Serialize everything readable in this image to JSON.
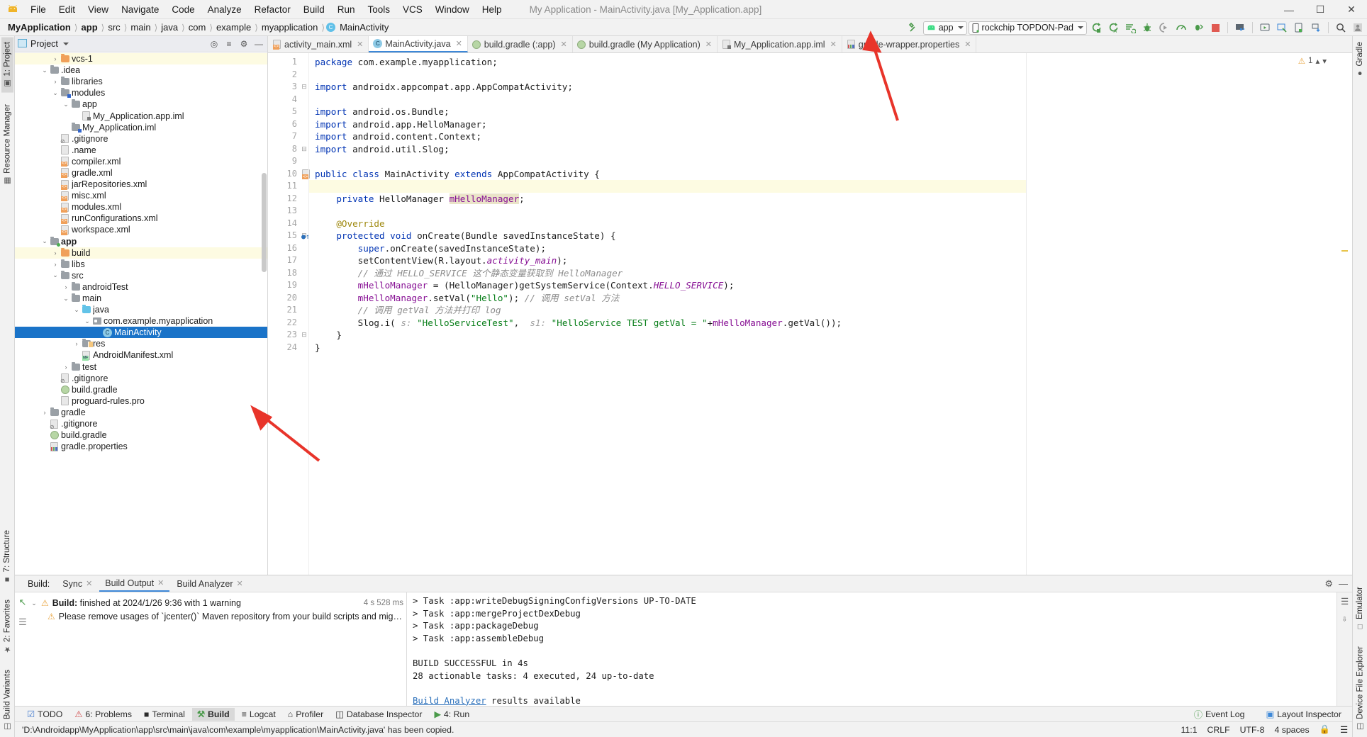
{
  "window": {
    "title": "My Application - MainActivity.java [My_Application.app]",
    "minimize": "—",
    "maximize": "☐",
    "close": "✕"
  },
  "menu": {
    "items": [
      "File",
      "Edit",
      "View",
      "Navigate",
      "Code",
      "Analyze",
      "Refactor",
      "Build",
      "Run",
      "Tools",
      "VCS",
      "Window",
      "Help"
    ]
  },
  "breadcrumb": {
    "items": [
      "MyApplication",
      "app",
      "src",
      "main",
      "java",
      "com",
      "example",
      "myapplication",
      "MainActivity"
    ],
    "class_icon": "C"
  },
  "toolbar": {
    "run_config": "app",
    "device": "rockchip TOPDON-Pad",
    "icons": [
      "hammer-build-icon",
      "run-icon",
      "run-coverage-icon",
      "apply-changes-icon",
      "debug-icon",
      "attach-debugger-icon",
      "profiler-icon",
      "apply-code-changes-icon",
      "stop-icon",
      "sdk-manager-icon",
      "avd-manager-icon",
      "layout-inspector-icon",
      "device-file-explorer-icon",
      "sync-gradle-icon",
      "search-icon",
      "avatar-icon"
    ]
  },
  "project_panel": {
    "title": "Project",
    "header_icons": [
      "target-icon",
      "collapse-all-icon",
      "settings-icon",
      "hide-icon"
    ],
    "tree": [
      {
        "label": "vcs-1",
        "depth": 3,
        "icon": "folder-orange",
        "twist": "›",
        "state": "highlight"
      },
      {
        "label": ".idea",
        "depth": 2,
        "icon": "folder",
        "twist": "⌄"
      },
      {
        "label": "libraries",
        "depth": 3,
        "icon": "folder",
        "twist": "›"
      },
      {
        "label": "modules",
        "depth": 3,
        "icon": "folder-module",
        "twist": "⌄"
      },
      {
        "label": "app",
        "depth": 4,
        "icon": "folder",
        "twist": "⌄"
      },
      {
        "label": "My_Application.app.iml",
        "depth": 5,
        "icon": "iml-file",
        "twist": ""
      },
      {
        "label": "My_Application.iml",
        "depth": 4,
        "icon": "iml-module",
        "twist": ""
      },
      {
        "label": ".gitignore",
        "depth": 3,
        "icon": "gitignore-file",
        "twist": ""
      },
      {
        "label": ".name",
        "depth": 3,
        "icon": "text-file",
        "twist": ""
      },
      {
        "label": "compiler.xml",
        "depth": 3,
        "icon": "xml-file",
        "twist": ""
      },
      {
        "label": "gradle.xml",
        "depth": 3,
        "icon": "xml-file",
        "twist": ""
      },
      {
        "label": "jarRepositories.xml",
        "depth": 3,
        "icon": "xml-file",
        "twist": ""
      },
      {
        "label": "misc.xml",
        "depth": 3,
        "icon": "xml-file",
        "twist": ""
      },
      {
        "label": "modules.xml",
        "depth": 3,
        "icon": "xml-file",
        "twist": ""
      },
      {
        "label": "runConfigurations.xml",
        "depth": 3,
        "icon": "xml-file",
        "twist": ""
      },
      {
        "label": "workspace.xml",
        "depth": 3,
        "icon": "xml-file",
        "twist": ""
      },
      {
        "label": "app",
        "depth": 2,
        "icon": "folder-module-green",
        "twist": "⌄",
        "bold": true
      },
      {
        "label": "build",
        "depth": 3,
        "icon": "folder-orange",
        "twist": "›",
        "state": "highlight"
      },
      {
        "label": "libs",
        "depth": 3,
        "icon": "folder",
        "twist": "›"
      },
      {
        "label": "src",
        "depth": 3,
        "icon": "folder",
        "twist": "⌄"
      },
      {
        "label": "androidTest",
        "depth": 4,
        "icon": "folder",
        "twist": "›"
      },
      {
        "label": "main",
        "depth": 4,
        "icon": "folder",
        "twist": "⌄"
      },
      {
        "label": "java",
        "depth": 5,
        "icon": "folder-blue",
        "twist": "⌄"
      },
      {
        "label": "com.example.myapplication",
        "depth": 6,
        "icon": "package-icon",
        "twist": "⌄"
      },
      {
        "label": "MainActivity",
        "depth": 7,
        "icon": "class-icon",
        "twist": "",
        "state": "selected"
      },
      {
        "label": "res",
        "depth": 5,
        "icon": "res-folder",
        "twist": "›"
      },
      {
        "label": "AndroidManifest.xml",
        "depth": 5,
        "icon": "manifest-file",
        "twist": ""
      },
      {
        "label": "test",
        "depth": 4,
        "icon": "folder",
        "twist": "›"
      },
      {
        "label": ".gitignore",
        "depth": 3,
        "icon": "gitignore-file",
        "twist": ""
      },
      {
        "label": "build.gradle",
        "depth": 3,
        "icon": "gradle-file",
        "twist": ""
      },
      {
        "label": "proguard-rules.pro",
        "depth": 3,
        "icon": "text-file",
        "twist": ""
      },
      {
        "label": "gradle",
        "depth": 2,
        "icon": "folder",
        "twist": "›"
      },
      {
        "label": ".gitignore",
        "depth": 2,
        "icon": "gitignore-file",
        "twist": ""
      },
      {
        "label": "build.gradle",
        "depth": 2,
        "icon": "gradle-file",
        "twist": ""
      },
      {
        "label": "gradle.properties",
        "depth": 2,
        "icon": "properties-file",
        "twist": ""
      }
    ]
  },
  "editor": {
    "tabs": [
      {
        "label": "activity_main.xml",
        "icon": "xml-file",
        "active": false
      },
      {
        "label": "MainActivity.java",
        "icon": "class-icon",
        "active": true
      },
      {
        "label": "build.gradle (:app)",
        "icon": "gradle-file",
        "active": false
      },
      {
        "label": "build.gradle (My Application)",
        "icon": "gradle-file",
        "active": false
      },
      {
        "label": "My_Application.app.iml",
        "icon": "iml-file",
        "active": false
      },
      {
        "label": "gradle-wrapper.properties",
        "icon": "properties-file",
        "active": false
      }
    ],
    "warning_count": "1",
    "lines": [
      {
        "n": 1,
        "html": "<span class=\"kw\">package</span> com.example.myapplication;"
      },
      {
        "n": 2,
        "html": ""
      },
      {
        "n": 3,
        "html": "<span class=\"kw\">import</span> androidx.appcompat.app.AppCompatActivity;",
        "fold": "⊟"
      },
      {
        "n": 4,
        "html": ""
      },
      {
        "n": 5,
        "html": "<span class=\"kw\">import</span> android.os.Bundle;"
      },
      {
        "n": 6,
        "html": "<span class=\"kw\">import</span> android.app.HelloManager;"
      },
      {
        "n": 7,
        "html": "<span class=\"kw\">import</span> android.content.Context;"
      },
      {
        "n": 8,
        "html": "<span class=\"kw\">import</span> android.util.Slog;",
        "fold": "⊟"
      },
      {
        "n": 9,
        "html": ""
      },
      {
        "n": 10,
        "html": "<span class=\"kw\">public class</span> MainActivity <span class=\"kw\">extends</span> AppCompatActivity {",
        "gmark": "class-gutter-icon"
      },
      {
        "n": 11,
        "html": "",
        "hl": true
      },
      {
        "n": 12,
        "html": "    <span class=\"kw\">private</span> HelloManager <span class=\"hi-ident fld\">mHelloManager</span>;"
      },
      {
        "n": 13,
        "html": ""
      },
      {
        "n": 14,
        "html": "    <span class=\"ann\">@Override</span>"
      },
      {
        "n": 15,
        "html": "    <span class=\"kw\">protected void</span> onCreate(Bundle savedInstanceState) {",
        "gmark": "override-icon",
        "fold": "⊟"
      },
      {
        "n": 16,
        "html": "        <span class=\"kw\">super</span>.onCreate(savedInstanceState);"
      },
      {
        "n": 17,
        "html": "        setContentView(R.layout.<span class=\"stc\">activity_main</span>);"
      },
      {
        "n": 18,
        "html": "        <span class=\"cmt\">// 通过 HELLO_SERVICE 这个静态变量获取到 HelloManager</span>"
      },
      {
        "n": 19,
        "html": "        <span class=\"fld\">mHelloManager</span> = (HelloManager)getSystemService(Context.<span class=\"stc\">HELLO_SERVICE</span>);"
      },
      {
        "n": 20,
        "html": "        <span class=\"fld\">mHelloManager</span>.setVal(<span class=\"str\">\"Hello\"</span>); <span class=\"cmt\">// 调用 setVal 方法</span>"
      },
      {
        "n": 21,
        "html": "        <span class=\"cmt\">// 调用 getVal 方法并打印 log</span>"
      },
      {
        "n": 22,
        "html": "        Slog.i( <span class=\"hint\">s:</span> <span class=\"str\">\"HelloServiceTest\"</span>,  <span class=\"hint\">s1:</span> <span class=\"str\">\"HelloService TEST getVal = \"</span>+<span class=\"fld\">mHelloManager</span>.getVal());"
      },
      {
        "n": 23,
        "html": "    }",
        "fold": "⊟"
      },
      {
        "n": 24,
        "html": "}"
      }
    ]
  },
  "build_panel": {
    "title": "Build:",
    "tabs": [
      {
        "label": "Sync",
        "active": false,
        "closable": true
      },
      {
        "label": "Build Output",
        "active": true,
        "closable": true
      },
      {
        "label": "Build Analyzer",
        "active": false,
        "closable": true
      }
    ],
    "tree": {
      "status_prefix": "Build:",
      "status_text": "finished at 2024/1/26 9:36 with 1 warning",
      "duration": "4 s 528 ms",
      "warning": "Please remove usages of `jcenter()` Maven repository from your build scripts and migrate your bu"
    },
    "output_lines": [
      "> Task :app:writeDebugSigningConfigVersions UP-TO-DATE",
      "> Task :app:mergeProjectDexDebug",
      "> Task :app:packageDebug",
      "> Task :app:assembleDebug",
      "",
      "BUILD SUCCESSFUL in 4s",
      "28 actionable tasks: 4 executed, 24 up-to-date",
      ""
    ],
    "analyzer_link": "Build Analyzer",
    "analyzer_suffix": " results available"
  },
  "left_rail": {
    "top": [
      {
        "label": "1: Project",
        "icon": "project-icon",
        "active": true
      },
      {
        "label": "Resource Manager",
        "icon": "resource-icon",
        "active": false
      }
    ],
    "bottom": [
      {
        "label": "7: Structure",
        "icon": "structure-icon"
      },
      {
        "label": "2: Favorites",
        "icon": "favorites-icon"
      },
      {
        "label": "Build Variants",
        "icon": "build-variants-icon"
      }
    ]
  },
  "right_rail": {
    "items": [
      {
        "label": "Gradle",
        "icon": "gradle-icon"
      },
      {
        "label": "Emulator",
        "icon": "emulator-icon"
      },
      {
        "label": "Device File Explorer",
        "icon": "device-file-icon"
      }
    ]
  },
  "bottom_tools": {
    "left": [
      {
        "label": "TODO",
        "icon": "todo-icon",
        "active": false
      },
      {
        "label": "6: Problems",
        "icon": "problems-icon",
        "active": false
      },
      {
        "label": "Terminal",
        "icon": "terminal-icon",
        "active": false
      },
      {
        "label": "Build",
        "icon": "build-icon",
        "active": true
      },
      {
        "label": "Logcat",
        "icon": "logcat-icon",
        "active": false
      },
      {
        "label": "Profiler",
        "icon": "profiler-icon",
        "active": false
      },
      {
        "label": "Database Inspector",
        "icon": "database-icon",
        "active": false
      },
      {
        "label": "4: Run",
        "icon": "run-icon",
        "active": false
      }
    ],
    "right": [
      {
        "label": "Event Log",
        "icon": "event-log-icon"
      },
      {
        "label": "Layout Inspector",
        "icon": "layout-inspector-icon"
      }
    ]
  },
  "status_bar": {
    "message": "'D:\\Androidapp\\MyApplication\\app\\src\\main\\java\\com\\example\\myapplication\\MainActivity.java' has been copied.",
    "caret": "11:1",
    "line_sep": "CRLF",
    "encoding": "UTF-8",
    "indent": "4 spaces",
    "lock_icon": "lock-icon"
  },
  "colors": {
    "accent": "#3d88d8",
    "selection": "#1a73c8",
    "highlight": "#fdfbe2",
    "green": "#4a9a4a",
    "keyword": "#0033b3",
    "string": "#067d17",
    "annotation_arrow": "#e8342a"
  }
}
